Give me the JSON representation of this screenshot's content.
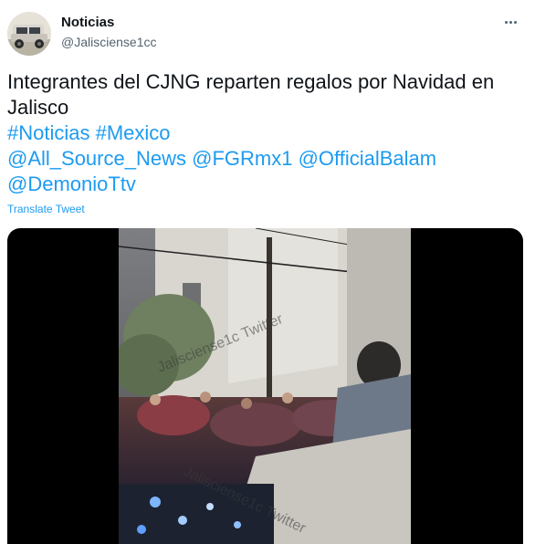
{
  "author": {
    "name": "Noticias",
    "handle": "@Jalisciense1cc",
    "avatar_icon": "avatar-truck-photo"
  },
  "more_icon": "more-horizontal-icon",
  "tweet": {
    "line1": "Integrantes del CJNG reparten regalos por Navidad en",
    "line2": "Jalisco",
    "hashtags": [
      "#Noticias",
      "#Mexico"
    ],
    "mentions_line1": [
      "@All_Source_News",
      "@FGRmx1",
      "@OfficialBalam"
    ],
    "mentions_line2": [
      "@DemonioTtv"
    ]
  },
  "translate_label": "Translate Tweet",
  "media": {
    "watermark_top": "Jalisciense1c Twitter",
    "watermark_bottom": "Jalisciense1c Twitter"
  },
  "colors": {
    "link": "#1d9bf0",
    "text": "#0f1419",
    "secondary": "#536471",
    "media_bg": "#000000"
  }
}
